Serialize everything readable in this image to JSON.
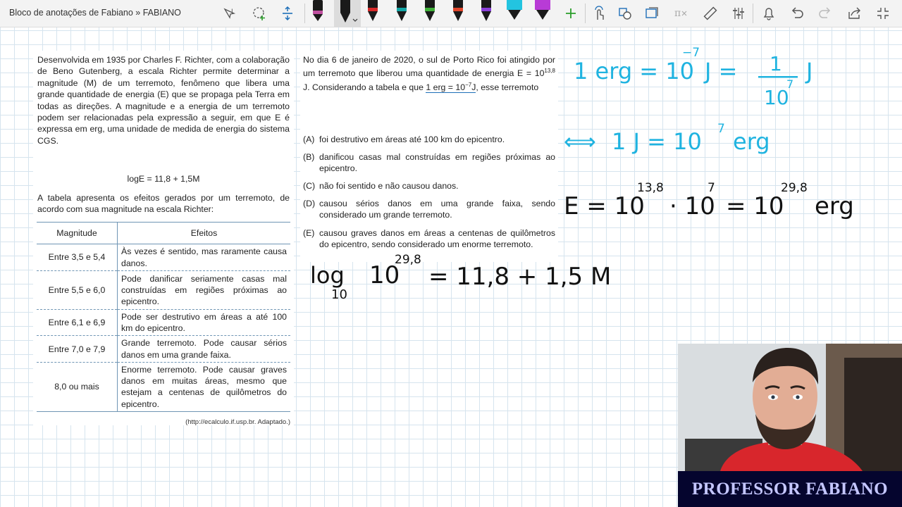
{
  "window": {
    "title": "Bloco de anotações de Fabiano » FABIANO"
  },
  "toolbar": {
    "tools": [
      "lasso-text-icon",
      "lasso-select-icon",
      "add-space-icon",
      "pen-black-1",
      "pen-black-2",
      "pen-red",
      "pen-teal",
      "pen-green",
      "pen-red-2",
      "pen-purple",
      "pen-cyan",
      "pen-violet",
      "add-pen-icon",
      "touch-icon",
      "shape-icon",
      "convert-icon",
      "math-icon",
      "ruler-icon",
      "adjust-icon",
      "bell-icon",
      "undo-icon",
      "redo-icon",
      "share-icon",
      "fullscreen-icon"
    ],
    "colors": {
      "red": "#d62828",
      "teal": "#12a6a6",
      "green": "#3fb039",
      "purple": "#8b3fd9",
      "cyan": "#23c4e0",
      "violet": "#b83bd6"
    }
  },
  "document": {
    "intro": "Desenvolvida em 1935 por Charles F. Richter, com a colaboração de Beno Gutenberg, a escala Richter permite determinar a magnitude (M) de um terremoto, fenômeno que libera uma grande quantidade de energia (E) que se propaga pela Terra em todas as direções. A magnitude e a energia de um terremoto podem ser relacionadas pela expressão a seguir, em que E é expressa em erg, uma unidade de medida de energia do sistema CGS.",
    "formula": "logE = 11,8 + 1,5M",
    "table_intro": "A tabela apresenta os efeitos gerados por um terremoto, de acordo com sua magnitude na escala Richter:",
    "table": {
      "headers": [
        "Magnitude",
        "Efeitos"
      ],
      "rows": [
        {
          "magnitude": "Entre 3,5 e 5,4",
          "effect": "Às vezes é sentido, mas raramente causa danos."
        },
        {
          "magnitude": "Entre 5,5 e 6,0",
          "effect": "Pode danificar seriamente casas mal construídas em regiões próximas ao epicentro."
        },
        {
          "magnitude": "Entre 6,1 e 6,9",
          "effect": "Pode ser destrutivo em áreas a até 100 km do epicentro."
        },
        {
          "magnitude": "Entre 7,0 e 7,9",
          "effect": "Grande terremoto. Pode causar sérios danos em uma grande faixa."
        },
        {
          "magnitude": "8,0 ou mais",
          "effect": "Enorme terremoto. Pode causar graves danos em muitas áreas, mesmo que estejam a centenas de quilômetros do epicentro."
        }
      ]
    },
    "source": "(http://ecalculo.if.usp.br. Adaptado.)",
    "question": {
      "p1": "No dia 6 de janeiro de 2020, o sul de Porto Rico foi atingido por um terremoto que liberou uma quantidade de energia E = 10",
      "exp1": "13,8",
      "p2": " J. Considerando a tabela e que ",
      "p3": "1 erg = 10",
      "exp2": "−7",
      "p4": "J",
      "p5": ", esse terremoto"
    },
    "options": [
      {
        "letter": "(A)",
        "text": "foi destrutivo em áreas até 100 km do epicentro."
      },
      {
        "letter": "(B)",
        "text": "danificou casas mal construídas em regiões próximas ao epicentro."
      },
      {
        "letter": "(C)",
        "text": "não foi sentido e não causou danos."
      },
      {
        "letter": "(D)",
        "text": "causou sérios danos em uma grande faixa, sendo considerado um grande terremoto."
      },
      {
        "letter": "(E)",
        "text": "causou graves danos em áreas a centenas de quilômetros do epicentro, sendo considerado um enorme terremoto."
      }
    ]
  },
  "handwriting": {
    "line1": {
      "a": "1 erg = 10",
      "a_exp": "−7",
      "b": "J =",
      "num": "1",
      "den": "10",
      "den_exp": "7",
      "c": "J"
    },
    "line2": {
      "arrow": "⟺",
      "a": "1 J = 10",
      "a_exp": "7",
      "b": "erg"
    },
    "line3": {
      "a": "E = 10",
      "a_exp": "13,8",
      "b": "· 10",
      "b_exp": "7",
      "c": "= 10",
      "c_exp": "29,8",
      "d": "erg"
    },
    "line4": {
      "log": "log",
      "base": "10",
      "a": "10",
      "a_exp": "29,8",
      "b": "= 11,8 + 1,5 M"
    },
    "colors": {
      "blue": "#1fb3e0",
      "black": "#111111"
    }
  },
  "webcam": {
    "banner": "PROFESSOR FABIANO",
    "banner_color": "#05052e"
  }
}
